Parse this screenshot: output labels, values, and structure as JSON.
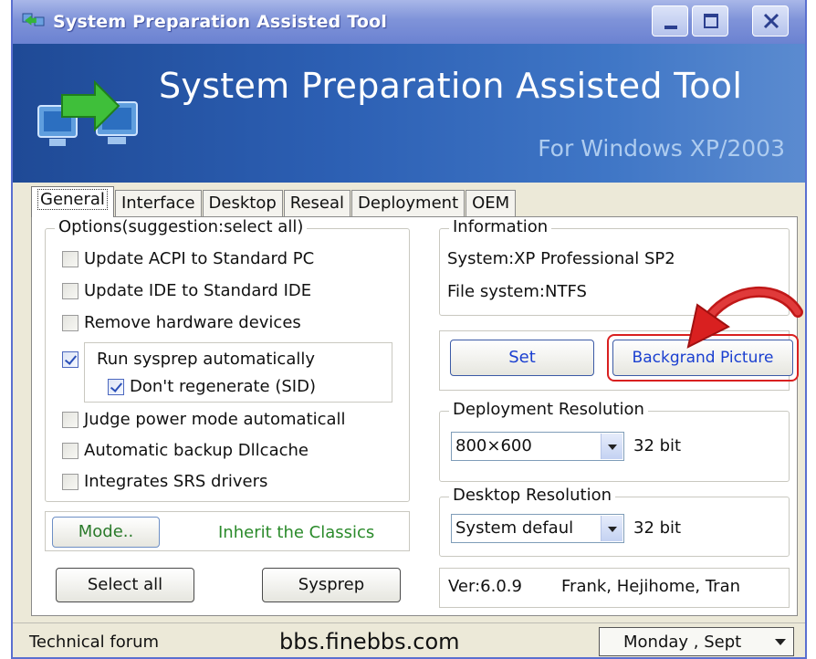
{
  "window": {
    "title": "System Preparation Assisted Tool"
  },
  "banner": {
    "title": "System Preparation Assisted Tool",
    "subtitle": "For Windows XP/2003"
  },
  "tabs": [
    {
      "label": "General",
      "active": true
    },
    {
      "label": "Interface",
      "active": false
    },
    {
      "label": "Desktop",
      "active": false
    },
    {
      "label": "Reseal",
      "active": false
    },
    {
      "label": "Deployment",
      "active": false
    },
    {
      "label": "OEM",
      "active": false
    }
  ],
  "options": {
    "group_label": "Options(suggestion:select all)",
    "items": [
      {
        "label": "Update ACPI to Standard PC",
        "checked": false
      },
      {
        "label": "Update IDE to Standard IDE",
        "checked": false
      },
      {
        "label": "Remove hardware devices",
        "checked": false
      },
      {
        "label": "Run sysprep automatically",
        "checked": true
      },
      {
        "label": "Don't regenerate (SID)",
        "checked": true
      },
      {
        "label": "Judge power mode automaticall",
        "checked": false
      },
      {
        "label": "Automatic backup Dllcache",
        "checked": false
      },
      {
        "label": "Integrates SRS drivers",
        "checked": false
      }
    ]
  },
  "mode": {
    "button_label": "Mode..",
    "current_mode": "Inherit the Classics"
  },
  "actions": {
    "select_all_label": "Select all",
    "sysprep_label": "Sysprep"
  },
  "information": {
    "group_label": "Information",
    "system": "System:XP Professional SP2",
    "file_system": "File system:NTFS"
  },
  "picture": {
    "set_label": "Set",
    "background_label": "Backgrand Picture"
  },
  "deployment_resolution": {
    "group_label": "Deployment Resolution",
    "value": "800×600",
    "depth": "32 bit"
  },
  "desktop_resolution": {
    "group_label": "Desktop Resolution",
    "value": "System defaul",
    "depth": "32 bit"
  },
  "version": {
    "text": "Ver:6.0.9",
    "authors": "Frank, Hejihome, Tran"
  },
  "status_bar": {
    "forum_label": "Technical forum",
    "forum_url": "bbs.finebbs.com",
    "date": "Monday   , Sept"
  },
  "colors": {
    "title_gradient": "#7f93d9",
    "banner_blue": "#2c5fb3",
    "mode_text": "#2a8a2a",
    "callout_red": "#d92020",
    "link_blue": "#1a3fd0"
  }
}
